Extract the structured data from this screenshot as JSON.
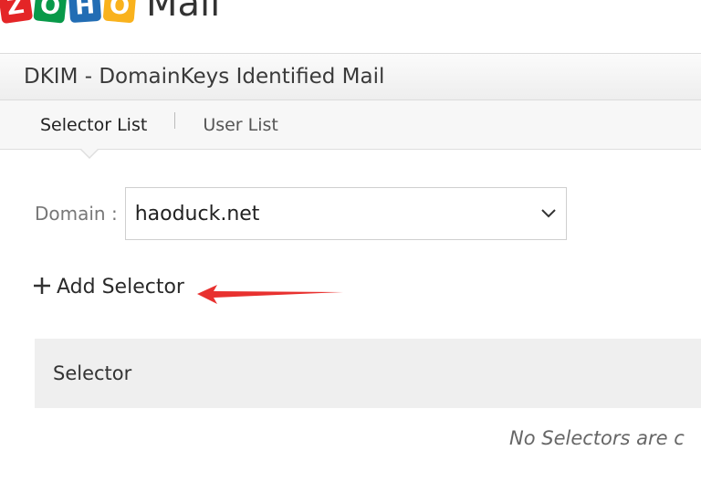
{
  "app": {
    "logo_letters": [
      "Z",
      "O",
      "H",
      "O"
    ],
    "logo_word": "Mail",
    "brand_colors": [
      "#e42527",
      "#089949",
      "#226db4",
      "#f9b21d"
    ]
  },
  "header": {
    "title": "DKIM - DomainKeys Identified Mail"
  },
  "tabs": [
    {
      "label": "Selector List",
      "active": true
    },
    {
      "label": "User List",
      "active": false
    }
  ],
  "domain": {
    "label": "Domain :",
    "selected": "haoduck.net",
    "icon": "chevron-down-icon"
  },
  "actions": {
    "add_selector_label": "Add Selector",
    "add_icon": "plus-icon",
    "annotation_color": "#e8312f"
  },
  "table": {
    "columns": [
      "Selector"
    ],
    "empty_message": "No Selectors are c"
  }
}
